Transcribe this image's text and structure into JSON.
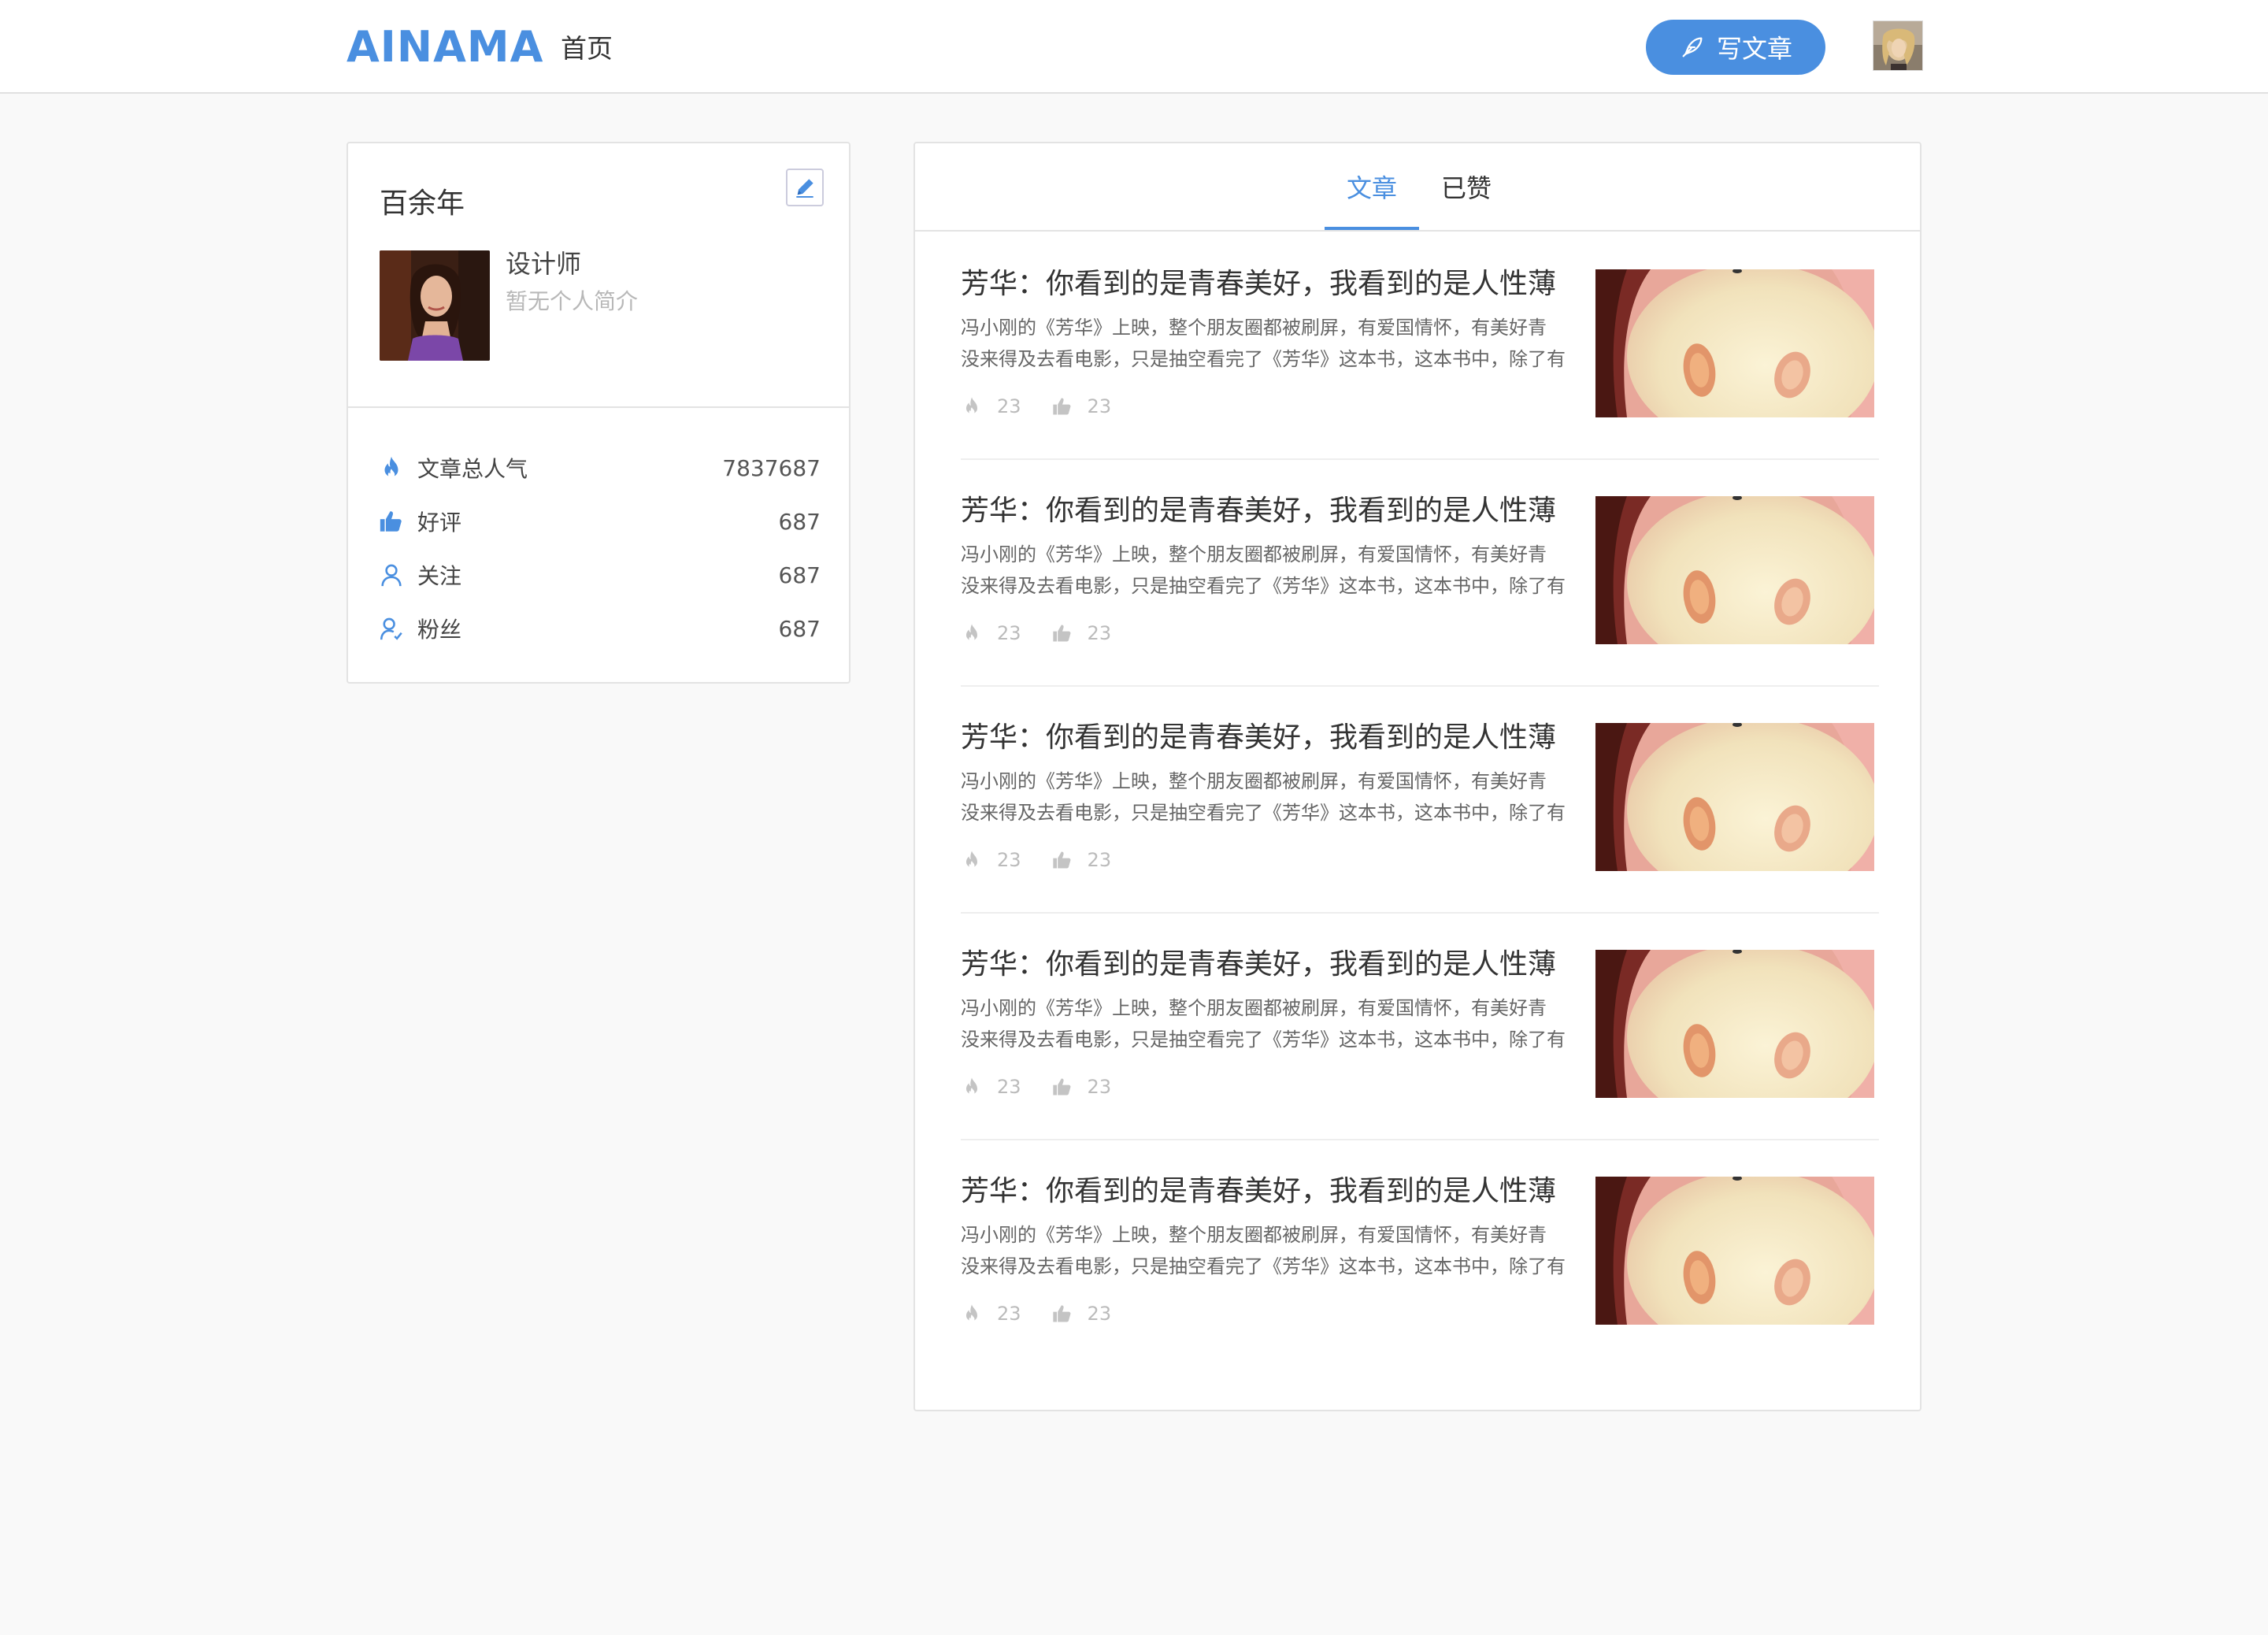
{
  "header": {
    "logo": "AINAMA",
    "nav_home": "首页",
    "write_button": "写文章"
  },
  "profile": {
    "name": "百余年",
    "job": "设计师",
    "bio": "暂无个人简介",
    "stats": [
      {
        "label": "文章总人气",
        "value": "7837687",
        "icon": "flame-icon"
      },
      {
        "label": "好评",
        "value": "687",
        "icon": "thumbs-up-icon"
      },
      {
        "label": "关注",
        "value": "687",
        "icon": "user-icon"
      },
      {
        "label": "粉丝",
        "value": "687",
        "icon": "fans-icon"
      }
    ]
  },
  "tabs": [
    {
      "label": "文章",
      "active": true
    },
    {
      "label": "已赞",
      "active": false
    }
  ],
  "articles": [
    {
      "title": "芳华：你看到的是青春美好，我看到的是人性薄",
      "desc_line1": "冯小刚的《芳华》上映，整个朋友圈都被刷屏，有爱国情怀，有美好青",
      "desc_line2": "没来得及去看电影，只是抽空看完了《芳华》这本书，这本书中，除了有",
      "views": "23",
      "likes": "23"
    },
    {
      "title": "芳华：你看到的是青春美好，我看到的是人性薄",
      "desc_line1": "冯小刚的《芳华》上映，整个朋友圈都被刷屏，有爱国情怀，有美好青",
      "desc_line2": "没来得及去看电影，只是抽空看完了《芳华》这本书，这本书中，除了有",
      "views": "23",
      "likes": "23"
    },
    {
      "title": "芳华：你看到的是青春美好，我看到的是人性薄",
      "desc_line1": "冯小刚的《芳华》上映，整个朋友圈都被刷屏，有爱国情怀，有美好青",
      "desc_line2": "没来得及去看电影，只是抽空看完了《芳华》这本书，这本书中，除了有",
      "views": "23",
      "likes": "23"
    },
    {
      "title": "芳华：你看到的是青春美好，我看到的是人性薄",
      "desc_line1": "冯小刚的《芳华》上映，整个朋友圈都被刷屏，有爱国情怀，有美好青",
      "desc_line2": "没来得及去看电影，只是抽空看完了《芳华》这本书，这本书中，除了有",
      "views": "23",
      "likes": "23"
    },
    {
      "title": "芳华：你看到的是青春美好，我看到的是人性薄",
      "desc_line1": "冯小刚的《芳华》上映，整个朋友圈都被刷屏，有爱国情怀，有美好青",
      "desc_line2": "没来得及去看电影，只是抽空看完了《芳华》这本书，这本书中，除了有",
      "views": "23",
      "likes": "23"
    }
  ],
  "colors": {
    "accent": "#4a8fe0",
    "background": "#f9f9f9",
    "muted_text": "#bbbbbb"
  }
}
